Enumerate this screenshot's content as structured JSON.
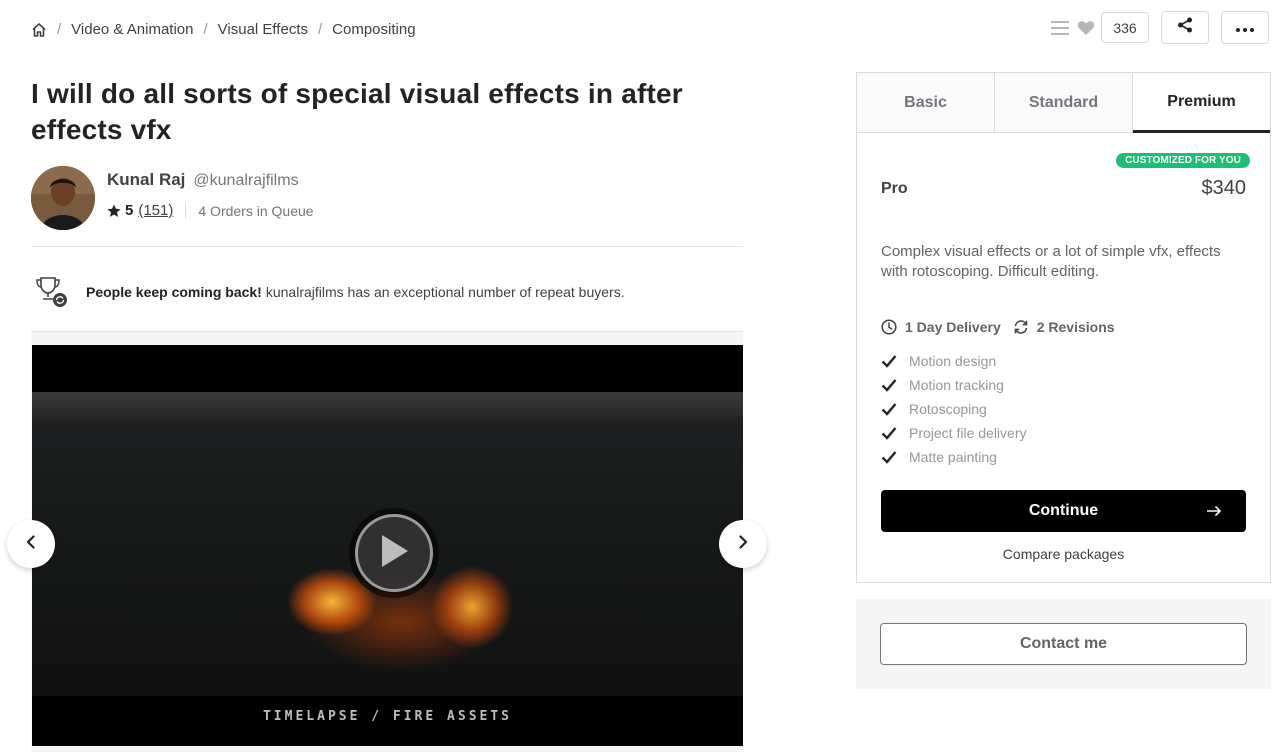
{
  "breadcrumb": {
    "home_icon": "home-icon",
    "items": [
      "Video & Animation",
      "Visual Effects",
      "Compositing"
    ],
    "separator": "/"
  },
  "actions": {
    "collect_count": "336",
    "icons": [
      "menu-lines-icon",
      "heart-icon",
      "share-icon",
      "more-icon"
    ]
  },
  "gig": {
    "title": "I will do all sorts of special visual effects in after effects vfx"
  },
  "seller": {
    "name": "Kunal Raj",
    "handle": "@kunalrajfilms",
    "rating": "5",
    "reviews": "(151)",
    "queue": "4 Orders in Queue"
  },
  "notice": {
    "bold": "People keep coming back!",
    "text": "kunalrajfilms has an exceptional number of repeat buyers."
  },
  "media": {
    "caption": "TIMELAPSE / FIRE ASSETS"
  },
  "package": {
    "tabs": [
      "Basic",
      "Standard",
      "Premium"
    ],
    "active_tab": "Premium",
    "badge": "CUSTOMIZED FOR YOU",
    "name": "Pro",
    "price": "$340",
    "description": "Complex visual effects or a lot of simple vfx, effects with rotoscoping. Difficult editing.",
    "delivery": "1 Day Delivery",
    "revisions": "2 Revisions",
    "features": [
      "Motion design",
      "Motion tracking",
      "Rotoscoping",
      "Project file delivery",
      "Matte painting"
    ],
    "continue_label": "Continue",
    "compare_label": "Compare packages"
  },
  "contact": {
    "label": "Contact me"
  },
  "colors": {
    "accent_green": "#1dbf73",
    "text_dark": "#222325",
    "text_muted": "#95979d"
  }
}
